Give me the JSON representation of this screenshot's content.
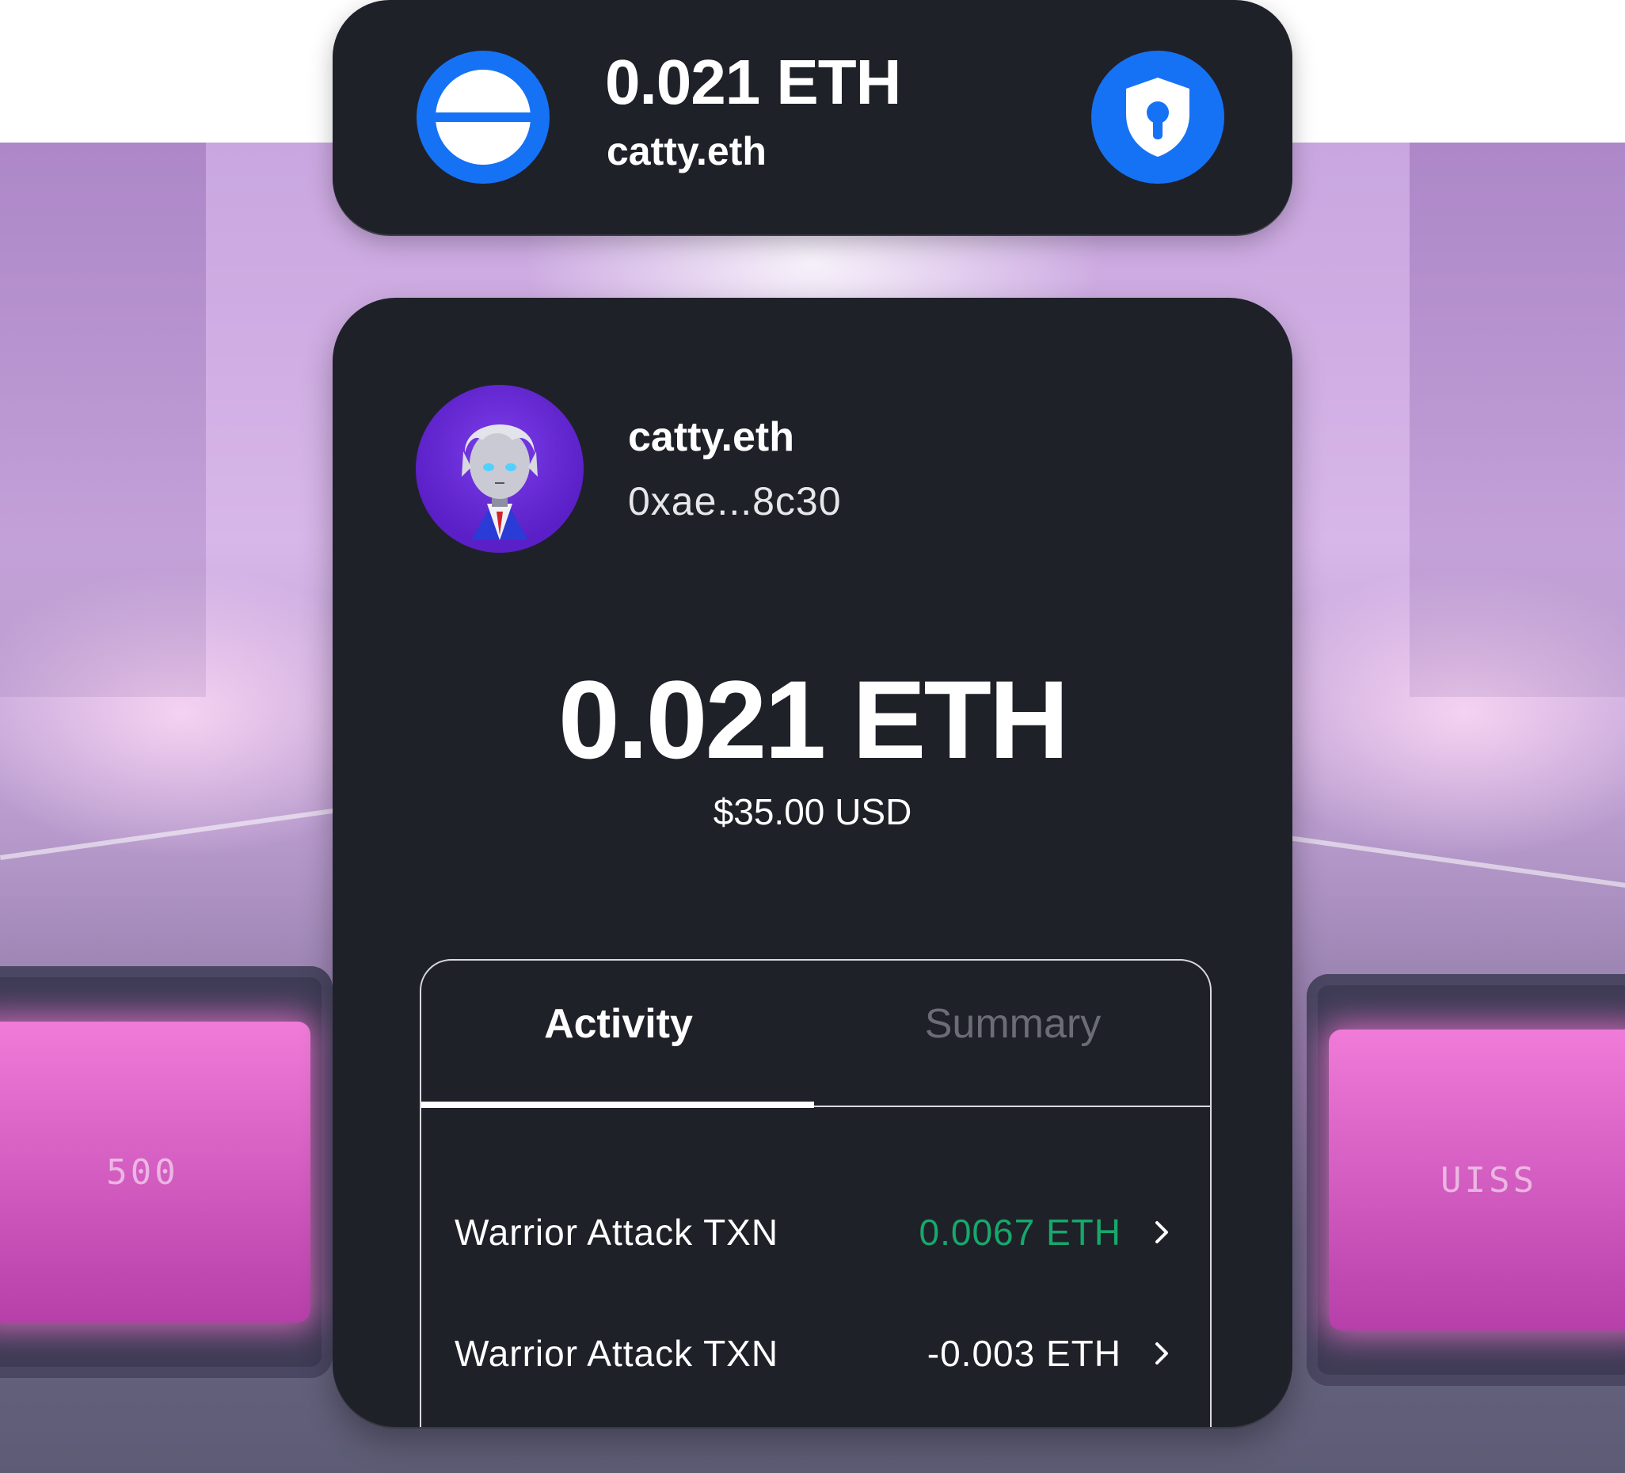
{
  "wallet_bar": {
    "balance": "0.021 ETH",
    "name": "catty.eth"
  },
  "profile": {
    "name": "catty.eth",
    "address": "0xae...8c30"
  },
  "balance": {
    "amount": "0.021 ETH",
    "usd": "$35.00 USD"
  },
  "tabs": [
    {
      "label": "Activity",
      "active": true
    },
    {
      "label": "Summary",
      "active": false
    }
  ],
  "transactions": [
    {
      "label": "Warrior Attack TXN",
      "amount": "0.0067 ETH",
      "color": "#17a86b"
    },
    {
      "label": "Warrior Attack TXN",
      "amount": "-0.003 ETH",
      "color": "#ffffff"
    }
  ],
  "background": {
    "left_screen_text": "500",
    "right_screen_text": "UISS"
  },
  "colors": {
    "card": "#1f2129",
    "accent_blue": "#1672f5",
    "positive_green": "#17a86b"
  },
  "icons": [
    "minus-circle-icon",
    "shield-keyhole-icon",
    "chevron-right-icon"
  ]
}
